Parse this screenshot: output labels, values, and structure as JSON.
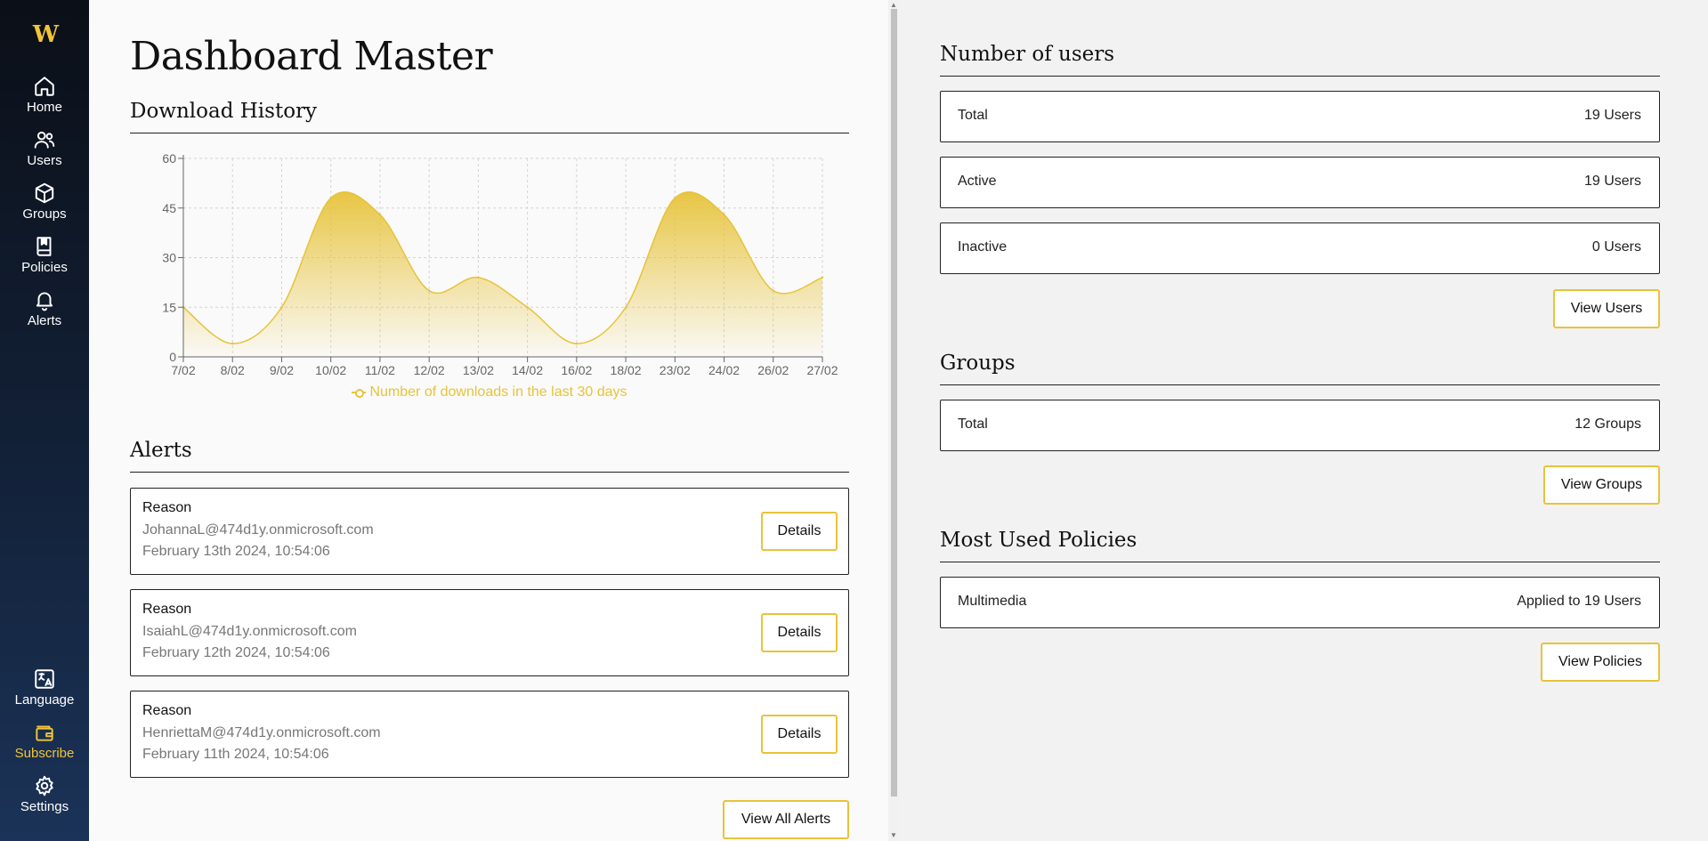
{
  "sidebar": {
    "logo": "W",
    "items": [
      {
        "label": "Home",
        "icon": "home-icon"
      },
      {
        "label": "Users",
        "icon": "users-icon"
      },
      {
        "label": "Groups",
        "icon": "cube-icon"
      },
      {
        "label": "Policies",
        "icon": "book-icon"
      },
      {
        "label": "Alerts",
        "icon": "bell-icon"
      }
    ],
    "bottom": [
      {
        "label": "Language",
        "icon": "translate-icon"
      },
      {
        "label": "Subscribe",
        "icon": "wallet-icon"
      },
      {
        "label": "Settings",
        "icon": "gear-icon"
      }
    ]
  },
  "main": {
    "title": "Dashboard Master",
    "download_history": {
      "title": "Download History",
      "legend": "Number of downloads in the last 30 days"
    },
    "alerts": {
      "title": "Alerts",
      "items": [
        {
          "reason": "Reason",
          "email": "JohannaL@474d1y.onmicrosoft.com",
          "date": "February 13th 2024, 10:54:06",
          "button": "Details"
        },
        {
          "reason": "Reason",
          "email": "IsaiahL@474d1y.onmicrosoft.com",
          "date": "February 12th 2024, 10:54:06",
          "button": "Details"
        },
        {
          "reason": "Reason",
          "email": "HenriettaM@474d1y.onmicrosoft.com",
          "date": "February 11th 2024, 10:54:06",
          "button": "Details"
        }
      ],
      "view_all": "View All Alerts"
    }
  },
  "right": {
    "users": {
      "title": "Number of users",
      "rows": [
        {
          "label": "Total",
          "value": "19 Users"
        },
        {
          "label": "Active",
          "value": "19 Users"
        },
        {
          "label": "Inactive",
          "value": "0 Users"
        }
      ],
      "button": "View Users"
    },
    "groups": {
      "title": "Groups",
      "rows": [
        {
          "label": "Total",
          "value": "12 Groups"
        }
      ],
      "button": "View Groups"
    },
    "policies": {
      "title": "Most Used Policies",
      "rows": [
        {
          "label": "Multimedia",
          "value": "Applied to 19 Users"
        }
      ],
      "button": "View Policies"
    }
  },
  "colors": {
    "accent": "#e7c33a",
    "sidebar_top": "#0b0f17",
    "sidebar_bottom": "#1b3358"
  },
  "chart_data": {
    "type": "area",
    "categories": [
      "7/02",
      "8/02",
      "9/02",
      "10/02",
      "11/02",
      "12/02",
      "13/02",
      "14/02",
      "16/02",
      "18/02",
      "23/02",
      "24/02",
      "26/02",
      "27/02"
    ],
    "series": [
      {
        "name": "Number of downloads in the last 30 days",
        "values": [
          15,
          4,
          15,
          48,
          43,
          20,
          24,
          15,
          4,
          15,
          48,
          43,
          20,
          24
        ]
      }
    ],
    "ylim": [
      0,
      60
    ],
    "yticks": [
      0,
      15,
      30,
      45,
      60
    ],
    "grid": true,
    "legend_position": "bottom"
  }
}
